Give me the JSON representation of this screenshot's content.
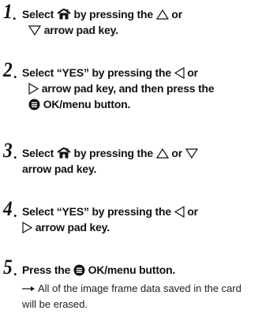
{
  "steps": [
    {
      "number": "1",
      "dot": ".",
      "parts": {
        "a": "Select",
        "b": "by pressing the",
        "c": "or",
        "d": "arrow pad key."
      }
    },
    {
      "number": "2",
      "dot": ".",
      "parts": {
        "a": "Select “YES” by pressing the",
        "b": "or",
        "c": "arrow pad key, and then press the",
        "d": "OK/menu button."
      }
    },
    {
      "number": "3",
      "dot": ".",
      "parts": {
        "a": "Select",
        "b": "by pressing the",
        "c": "or",
        "d": "arrow pad key."
      }
    },
    {
      "number": "4",
      "dot": ".",
      "parts": {
        "a": "Select “YES” by pressing the",
        "b": "or",
        "c": "arrow pad key."
      }
    },
    {
      "number": "5",
      "dot": ".",
      "parts": {
        "a": "Press the",
        "b": "OK/menu button."
      }
    }
  ],
  "result_note": "All of the image frame data saved in the card will be erased.",
  "icons": {
    "home_delete": "house-icon",
    "up": "up-triangle-icon",
    "down": "down-triangle-icon",
    "left": "left-triangle-icon",
    "right": "right-triangle-icon",
    "menu": "menu-button-icon",
    "arrow": "right-arrow-icon"
  }
}
